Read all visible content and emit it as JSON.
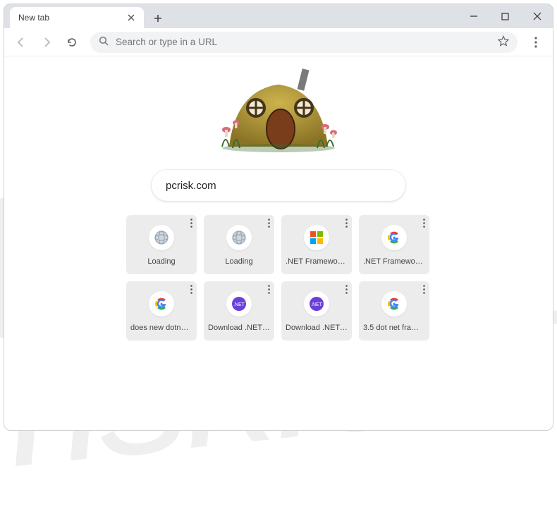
{
  "window": {
    "tab_title": "New tab",
    "minimize_tooltip": "Minimize",
    "maximize_tooltip": "Maximize",
    "close_tooltip": "Close"
  },
  "toolbar": {
    "back_tooltip": "Back",
    "forward_tooltip": "Forward",
    "reload_tooltip": "Reload",
    "omnibox_placeholder": "Search or type in a URL",
    "star_tooltip": "Bookmark",
    "menu_tooltip": "Menu"
  },
  "main": {
    "search_value": "pcrisk.com",
    "tiles": [
      {
        "label": "Loading",
        "icon": "globe"
      },
      {
        "label": "Loading",
        "icon": "globe"
      },
      {
        "label": ".NET Framework …",
        "icon": "microsoft"
      },
      {
        "label": ".NET Framework …",
        "icon": "google"
      },
      {
        "label": "does new dotnet…",
        "icon": "google"
      },
      {
        "label": "Download .NET F…",
        "icon": "dotnet"
      },
      {
        "label": "Download .NET F…",
        "icon": "dotnet"
      },
      {
        "label": "3.5 dot net fram…",
        "icon": "google"
      }
    ]
  },
  "watermark": {
    "text": "risk.com"
  }
}
